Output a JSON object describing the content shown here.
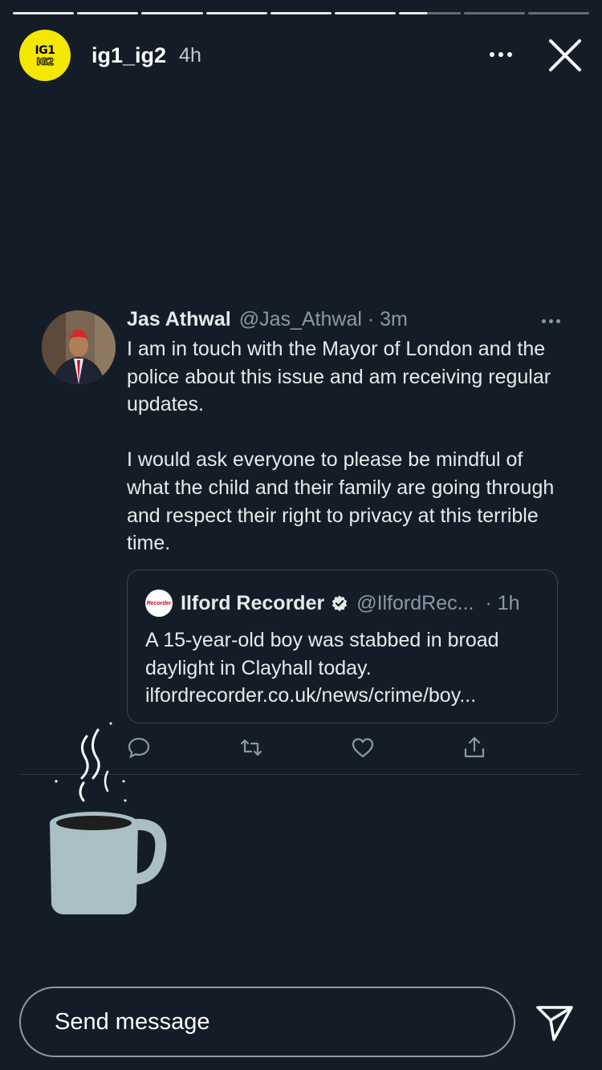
{
  "story": {
    "progress": [
      1,
      1,
      1,
      1,
      1,
      1,
      0.45,
      0,
      0
    ],
    "user": {
      "avatar_line1": "IG1",
      "avatar_line2": "IG2",
      "username": "ig1_ig2",
      "time": "4h"
    }
  },
  "tweet": {
    "name": "Jas Athwal",
    "handle": "@Jas_Athwal · 3m",
    "paragraphs": [
      "I am in touch with the Mayor of London and the police about this issue and am receiving regular updates.",
      "I would ask everyone to please be mindful of what the child and their family are going through and respect their right to privacy at this terrible time."
    ],
    "quoted": {
      "logo_text": "Recorder",
      "name": "Ilford Recorder",
      "handle": "@IlfordRec...",
      "time": "· 1h",
      "text": "A 15-year-old boy was stabbed in broad daylight in Clayhall today. ilfordrecorder.co.uk/news/crime/boy..."
    },
    "actions": [
      "reply-icon",
      "retweet-icon",
      "like-icon",
      "share-icon"
    ]
  },
  "footer": {
    "placeholder": "Send message"
  },
  "colors": {
    "background": "#141d27",
    "avatar_yellow": "#f4e700",
    "mug": "#a9bfc5"
  }
}
